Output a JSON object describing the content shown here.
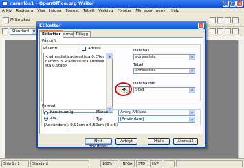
{
  "window": {
    "title": "namnlös1 - OpenOffice.org Writer"
  },
  "menu": [
    "Arkiv",
    "Redigera",
    "Visa",
    "Infoga",
    "Format",
    "Tabell",
    "Verktyg",
    "Fönster",
    "Min egen meny",
    "Hjälp"
  ],
  "toolbar": {
    "macro_label": "Mittmakro",
    "style_value": "Standard"
  },
  "dialog": {
    "title": "Etiketter",
    "tabs": [
      "Etiketter",
      "Format",
      "Tillägg"
    ],
    "labels_group": "Påskrift",
    "inscription_label": "Påskrift",
    "address_checkbox": "Adress",
    "inscription_text": "<adresslista.adresslista.0.Efternamn>\r> <adresslista.adresslista.0.Stad>",
    "database_label": "Databas",
    "database_value": "adresslista",
    "table_label": "Tabell",
    "table_value": "adresslista",
    "field_label": "Databasfält",
    "field_value": "Stad",
    "format_group": "Format",
    "continuous_label": "Kontinuerlig",
    "sheet_label": "Ark",
    "brand_label": "Märke",
    "brand_value": "Avery A4/Asia",
    "type_label": "Typ",
    "type_value": "[Användare]",
    "user_info": "[Användare]: 9,91cm x 6,50cm (3 x 6)",
    "buttons": {
      "new_doc": "Nytt dokument",
      "cancel": "Avbryt",
      "help": "Hjälp",
      "reset": "Återställ"
    },
    "insert_arrow": "◀"
  },
  "statusbar": {
    "page": "Sida 1 / 1",
    "style": "Standard",
    "zoom": "100%",
    "insert_mode": "INFGA",
    "selection_mode": "STD",
    "hyperlink": "HYP"
  }
}
